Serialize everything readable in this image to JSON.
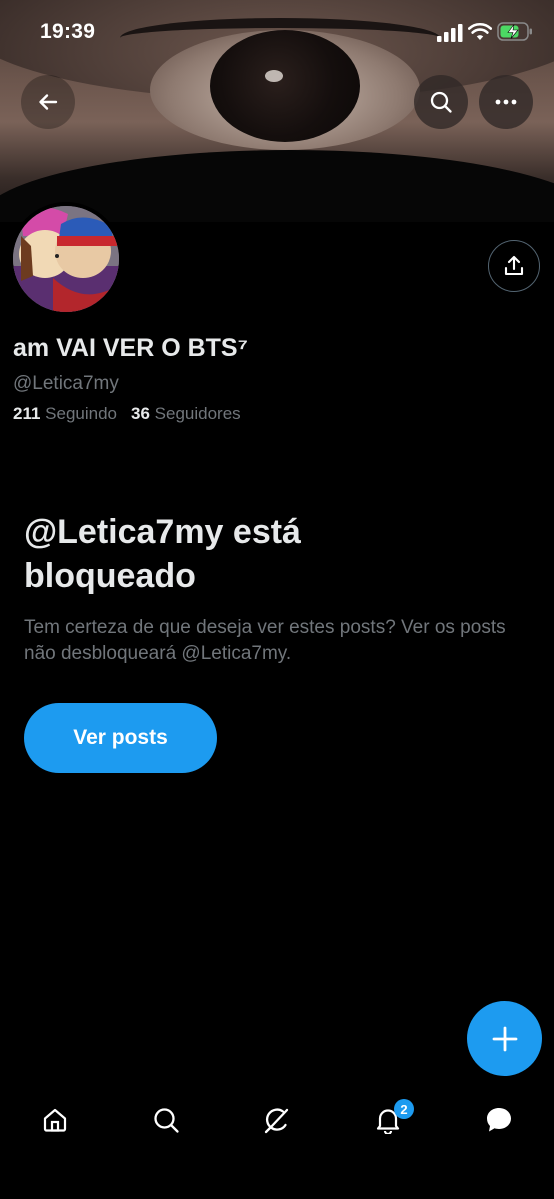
{
  "status_bar": {
    "time": "19:39"
  },
  "profile": {
    "display_name": "am VAI VER O BTS⁷",
    "handle": "@Letica7my",
    "following_count": "211",
    "following_label": "Seguindo",
    "followers_count": "36",
    "followers_label": "Seguidores"
  },
  "blocked": {
    "title": "@Letica7my está bloqueado",
    "description": "Tem certeza de que deseja ver estes posts? Ver os posts não desbloqueará @Letica7my.",
    "button_label": "Ver posts"
  },
  "bottom_nav": {
    "notifications_badge": "2"
  },
  "icons": {
    "back": "arrow-left-icon",
    "search": "search-icon",
    "more": "more-horizontal-icon",
    "share": "share-icon",
    "compose": "plus-icon",
    "home": "home-icon",
    "explore": "search-icon",
    "grok": "grok-icon",
    "notifications": "bell-icon",
    "messages": "chat-bubble-icon"
  },
  "colors": {
    "accent": "#1d9bf0",
    "background": "#000000",
    "text_primary": "#e7e9ea",
    "text_secondary": "#71767b"
  }
}
